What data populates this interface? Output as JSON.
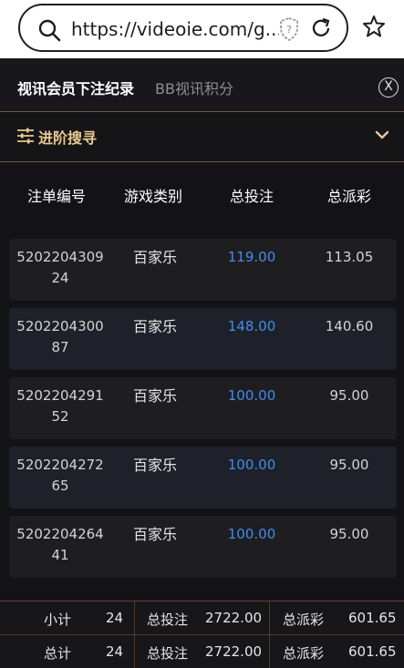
{
  "browser": {
    "url": "https://videoie.com/g..."
  },
  "header": {
    "tab_active": "视讯会员下注纪录",
    "tab_inactive": "BB视讯积分",
    "close_label": "X"
  },
  "advanced_search": {
    "label": "进阶搜寻"
  },
  "table": {
    "columns": [
      "注单编号",
      "游戏类别",
      "总投注",
      "总派彩"
    ],
    "rows": [
      {
        "id": "520220430924",
        "type": "百家乐",
        "bet": "119.00",
        "payout": "113.05"
      },
      {
        "id": "520220430087",
        "type": "百家乐",
        "bet": "148.00",
        "payout": "140.60"
      },
      {
        "id": "520220429152",
        "type": "百家乐",
        "bet": "100.00",
        "payout": "95.00"
      },
      {
        "id": "520220427265",
        "type": "百家乐",
        "bet": "100.00",
        "payout": "95.00"
      },
      {
        "id": "520220426441",
        "type": "百家乐",
        "bet": "100.00",
        "payout": "95.00"
      }
    ]
  },
  "summary": {
    "subtotal": {
      "label": "小计",
      "count": "24",
      "bet_label": "总投注",
      "bet": "2722.00",
      "payout_label": "总派彩",
      "payout": "601.65"
    },
    "total": {
      "label": "总计",
      "count": "24",
      "bet_label": "总投注",
      "bet": "2722.00",
      "payout_label": "总派彩",
      "payout": "601.65"
    }
  },
  "colors": {
    "accent_gold": "#e8c98e",
    "bet_blue": "#3f8ef0",
    "background": "#131317"
  }
}
